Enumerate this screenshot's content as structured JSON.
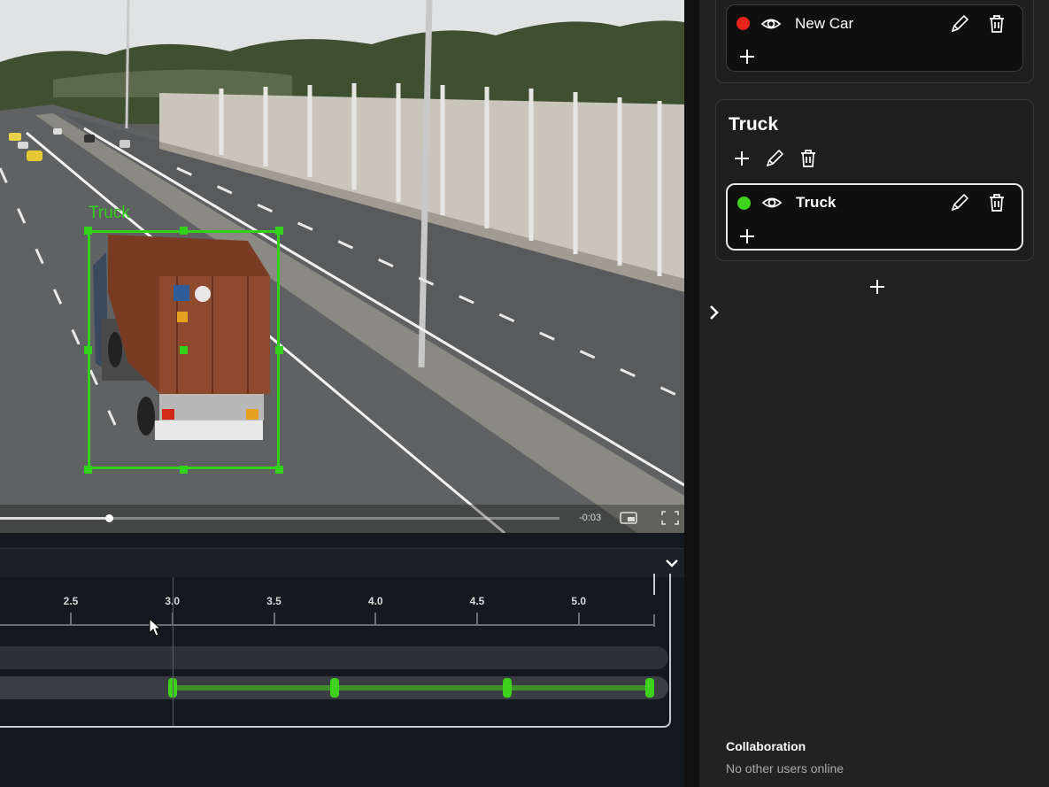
{
  "video": {
    "bbox_label": "Truck",
    "bbox_color": "#33d11a",
    "time_remaining": "-0:03",
    "progress_fraction": 0.195,
    "icons": [
      "pip-icon",
      "fullscreen-icon"
    ]
  },
  "timeline": {
    "tick_labels": [
      "2.5",
      "3.0",
      "3.5",
      "4.0",
      "4.5",
      "5.0"
    ],
    "keyframe_times": [
      3.0,
      3.8,
      4.65,
      5.35
    ],
    "playhead_time": 3.0,
    "segment_color": "#3ed21d",
    "icons": [
      "chevron-down-icon"
    ]
  },
  "sidebar": {
    "groups": [
      {
        "objects": [
          {
            "name": "New Car",
            "color": "#e8231c"
          }
        ]
      },
      {
        "title": "Truck",
        "objects": [
          {
            "name": "Truck",
            "color": "#3ed21d",
            "selected": true
          }
        ]
      }
    ],
    "icons": [
      "eye-icon",
      "pencil-icon",
      "trash-icon",
      "plus-icon",
      "chevron-right-icon"
    ],
    "collaboration": {
      "title": "Collaboration",
      "status": "No other users online"
    }
  }
}
